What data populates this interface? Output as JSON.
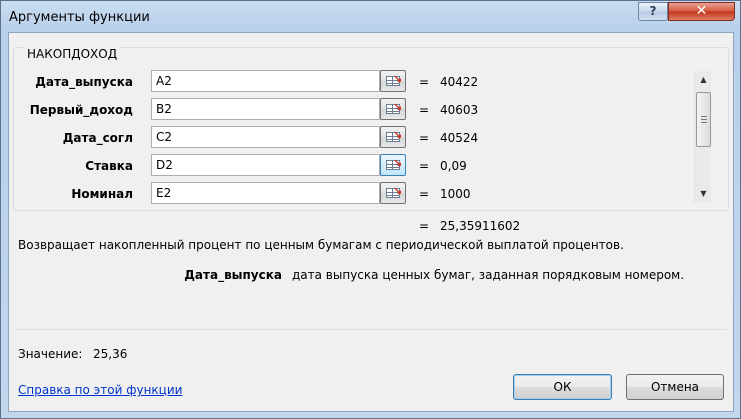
{
  "window": {
    "title": "Аргументы функции",
    "help_glyph": "?",
    "close_glyph": "✕"
  },
  "function": {
    "name": "НАКОПДОХОД",
    "args": [
      {
        "label": "Дата_выпуска",
        "value": "A2",
        "result": "40422"
      },
      {
        "label": "Первый_доход",
        "value": "B2",
        "result": "40603"
      },
      {
        "label": "Дата_согл",
        "value": "C2",
        "result": "40524"
      },
      {
        "label": "Ставка",
        "value": "D2",
        "result": "0,09"
      },
      {
        "label": "Номинал",
        "value": "E2",
        "result": "1000"
      }
    ],
    "equals": "=",
    "result": "25,35911602",
    "description": "Возвращает накопленный процент по ценным бумагам с периодической выплатой процентов.",
    "current_arg_name": "Дата_выпуска",
    "current_arg_description": "дата выпуска ценных бумаг, заданная порядковым номером."
  },
  "footer": {
    "value_label": "Значение:",
    "value": "25,36",
    "help_link": "Справка по этой функции",
    "ok_label": "ОК",
    "cancel_label": "Отмена"
  },
  "icons": {
    "ref_button": "collapse-dialog-icon",
    "scroll_up": "▲",
    "scroll_down": "▼"
  }
}
